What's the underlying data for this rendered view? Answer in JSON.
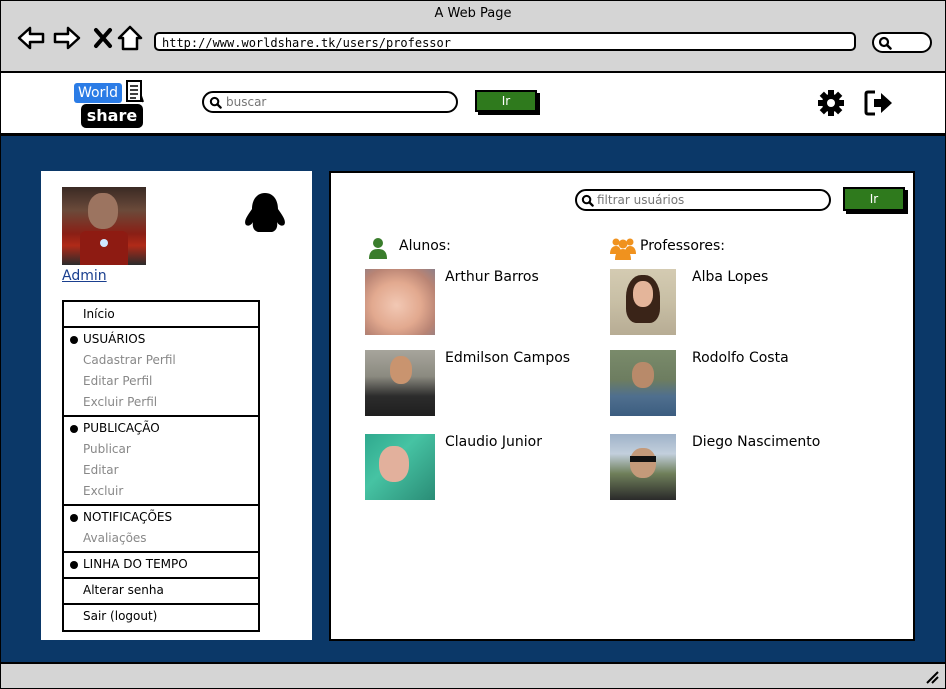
{
  "window": {
    "title": "A Web Page"
  },
  "browser": {
    "url": "http://www.worldshare.tk/users/professor",
    "nav_icons": [
      "back-arrow-icon",
      "forward-arrow-icon",
      "close-icon",
      "home-icon"
    ],
    "search_icon": "search-icon"
  },
  "header": {
    "logo_top": "World",
    "logo_bottom": "share",
    "search_placeholder": "buscar",
    "go_label": "Ir",
    "icons": [
      "gear-icon",
      "logout-icon"
    ]
  },
  "sidebar": {
    "admin_label": "Admin",
    "menu": {
      "inicio": "Início",
      "usuarios": "USUÁRIOS",
      "cadastrar": "Cadastrar Perfil",
      "editar_perfil": "Editar Perfil",
      "excluir_perfil": "Excluir Perfil",
      "publicacao": "PUBLICAÇÃO",
      "publicar": "Publicar",
      "editar": "Editar",
      "excluir": "Excluir",
      "notificacoes": "NOTIFICAÇÕES",
      "avaliacoes": "Avaliações",
      "linha_tempo": "LINHA DO TEMPO",
      "alterar_senha": "Alterar senha",
      "sair": "Sair (logout)"
    }
  },
  "main": {
    "filter_placeholder": "filtrar usuários",
    "go_label": "Ir",
    "alunos": {
      "title": "Alunos:",
      "items": [
        {
          "name": "Arthur Barros"
        },
        {
          "name": "Edmilson Campos"
        },
        {
          "name": "Claudio Junior"
        }
      ]
    },
    "professores": {
      "title": "Professores:",
      "items": [
        {
          "name": "Alba Lopes"
        },
        {
          "name": "Rodolfo Costa"
        },
        {
          "name": "Diego Nascimento"
        }
      ]
    }
  },
  "colors": {
    "background": "#0b3868",
    "accent_button": "#2f7a1d",
    "logo_blue": "#2b7ce6",
    "student_icon": "#3a7d2c",
    "teacher_icon": "#f0921e"
  }
}
